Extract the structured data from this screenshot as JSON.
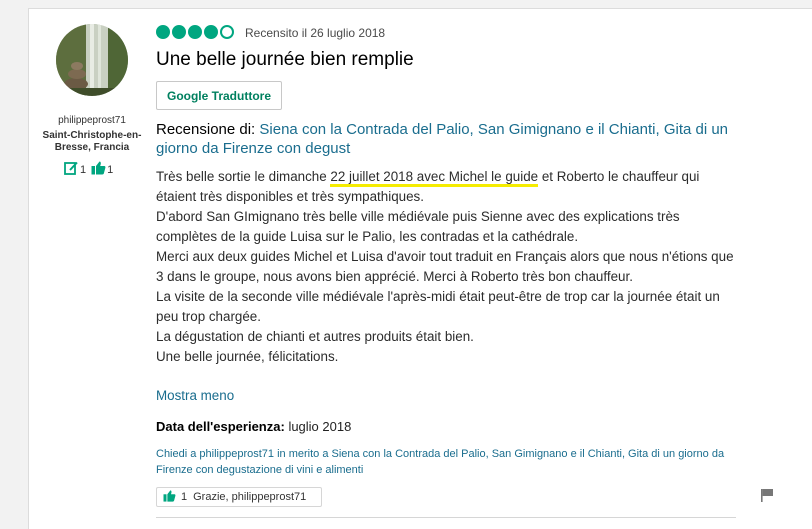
{
  "reviewer": {
    "username": "philippeprost71",
    "location": "Saint-Christophe-en-Bresse, Francia",
    "reviews_count": "1",
    "helpful_votes": "1"
  },
  "review": {
    "rating_bubbles": 4,
    "rating_max": 5,
    "date": "Recensito il 26 luglio 2018",
    "title": "Une belle journée bien remplie",
    "translate_label": "Google Traduttore",
    "review_of_prefix": "Recensione di:",
    "review_of_link": "Siena con la Contrada del Palio, San Gimignano e il Chianti, Gita di un giorno da Firenze con degust",
    "body": {
      "p1_start": "Très belle sortie le dimanche ",
      "p1_highlight": "22 juillet 2018 avec Michel le guide",
      "p1_end": " et Roberto le chauffeur qui étaient très disponibles et très sympathiques.",
      "p2": "D'abord San GImignano très belle ville médiévale puis Sienne avec des explications très complètes de la guide Luisa sur le Palio, les contradas et la cathédrale.",
      "p3": "Merci aux deux guides Michel et Luisa d'avoir tout traduit en Français alors que nous n'étions que 3 dans le groupe, nous avons bien apprécié. Merci à Roberto très bon chauffeur.",
      "p4": "La visite de la seconde ville médiévale l'après-midi était peut-être de trop car la journée était un peu trop chargée.",
      "p5": "La dégustation de chianti et autres produits était bien.",
      "p6": "Une belle journée, félicitations."
    },
    "show_less": "Mostra meno",
    "experience_label": "Data dell'esperienza:",
    "experience_value": "luglio 2018",
    "ask_link": "Chiedi a philippeprost71 in merito a Siena con la Contrada del Palio, San Gimignano e il Chianti, Gita di un giorno da Firenze con degustazione di vini e alimenti",
    "thanks_count": "1",
    "thanks_label": "Grazie, philippeprost71"
  },
  "icons": {
    "review": "pencil-note-icon",
    "helpful": "thumbs-up-icon",
    "report": "flag-icon"
  },
  "colors": {
    "brand_green": "#00a680",
    "link_blue": "#1a6d8e",
    "highlight": "#f5ec00"
  }
}
